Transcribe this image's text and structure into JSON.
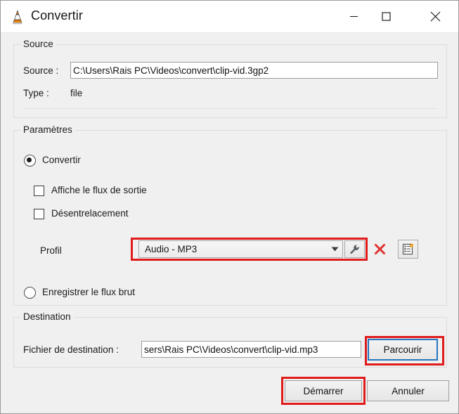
{
  "window": {
    "title": "Convertir",
    "icon": "vlc-cone-icon",
    "controls": {
      "minimize": "minimize-icon",
      "maximize": "maximize-icon",
      "close": "close-icon"
    }
  },
  "source_group": {
    "legend": "Source",
    "source_label": "Source :",
    "source_value": "C:\\Users\\Rais PC\\Videos\\convert\\clip-vid.3gp2",
    "type_label": "Type :",
    "type_value": "file"
  },
  "parameters_group": {
    "legend": "Paramètres",
    "convert_radio_label": "Convertir",
    "convert_radio_selected": true,
    "show_output_checkbox_label": "Affiche le flux de sortie",
    "show_output_checked": false,
    "deinterlace_checkbox_label": "Désentrelacement",
    "deinterlace_checked": false,
    "profile_label": "Profil",
    "profile_value": "Audio - MP3",
    "profile_edit_icon": "wrench-icon",
    "profile_delete_icon": "delete-x-icon",
    "profile_new_icon": "new-profile-icon",
    "raw_stream_radio_label": "Enregistrer le flux brut",
    "raw_stream_selected": false
  },
  "destination_group": {
    "legend": "Destination",
    "file_label": "Fichier de destination :",
    "file_value": "sers\\Rais PC\\Videos\\convert\\clip-vid.mp3",
    "browse_button": "Parcourir"
  },
  "footer": {
    "start_button": "Démarrer",
    "cancel_button": "Annuler"
  },
  "colors": {
    "annotation": "#e01b1b",
    "focus": "#2476bf",
    "window_bg": "#f0f0f0",
    "titlebar_bg": "#ffffff",
    "delete_icon": "#e03131",
    "vlc_cone": "#f08200"
  }
}
